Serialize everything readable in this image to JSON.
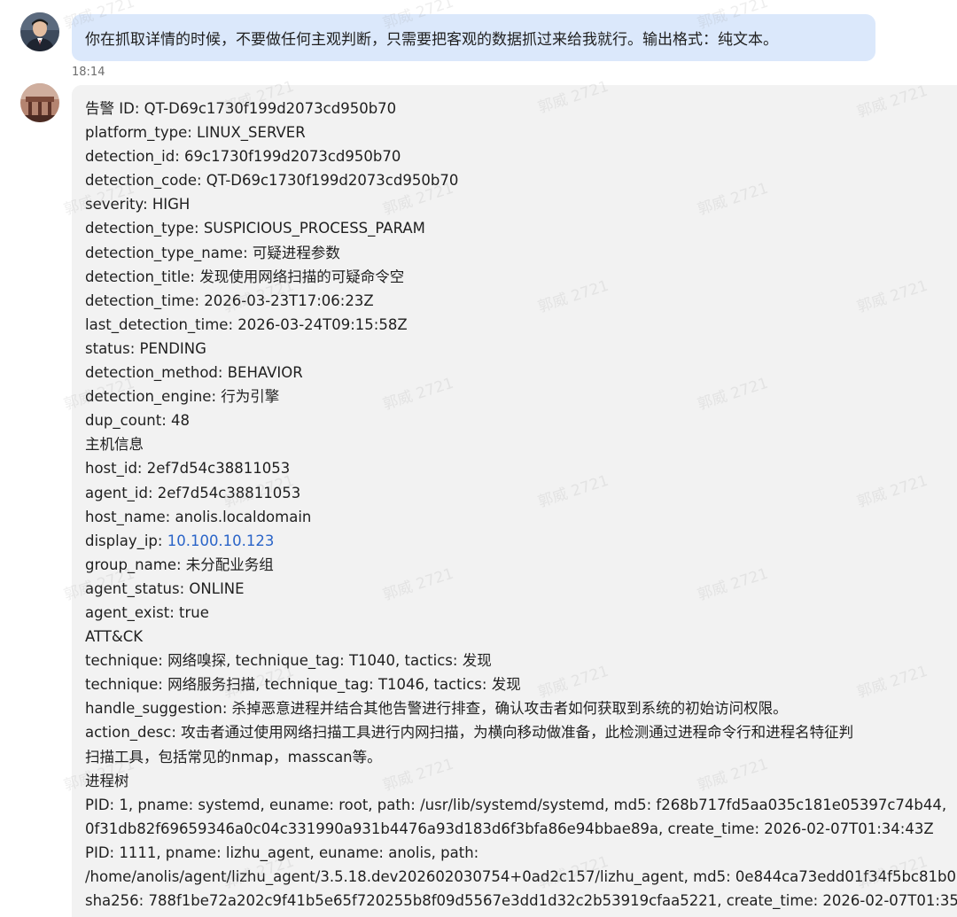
{
  "conversation": {
    "user_message": "你在抓取详情的时候，不要做任何主观判断，只需要把客观的数据抓过来给我就行。输出格式：纯文本。",
    "timestamp": "18:14",
    "watermark_text": "郭威 2721",
    "reply": {
      "line_01": "告警 ID: QT-D69c1730f199d2073cd950b70",
      "line_02": "platform_type: LINUX_SERVER",
      "line_03": "detection_id: 69c1730f199d2073cd950b70",
      "line_04": "detection_code: QT-D69c1730f199d2073cd950b70",
      "line_05": "severity: HIGH",
      "line_06": "detection_type: SUSPICIOUS_PROCESS_PARAM",
      "line_07": "detection_type_name: 可疑进程参数",
      "line_08": "detection_title: 发现使用网络扫描的可疑命令空",
      "line_09": "detection_time: 2026-03-23T17:06:23Z",
      "line_10": "last_detection_time: 2026-03-24T09:15:58Z",
      "line_11": "status: PENDING",
      "line_12": "detection_method: BEHAVIOR",
      "line_13": "detection_engine: 行为引擎",
      "line_14": "dup_count: 48",
      "line_15": "主机信息",
      "line_16": "host_id: 2ef7d54c38811053",
      "line_17": "agent_id: 2ef7d54c38811053",
      "line_18": "host_name: anolis.localdomain",
      "line_19_label": "display_ip: ",
      "line_19_ip": "10.100.10.123",
      "line_20": "group_name: 未分配业务组",
      "line_21": "agent_status: ONLINE",
      "line_22": "agent_exist: true",
      "line_23": "ATT&CK",
      "line_24": "technique: 网络嗅探, technique_tag: T1040, tactics: 发现",
      "line_25": "technique: 网络服务扫描, technique_tag: T1046, tactics: 发现",
      "line_26": "handle_suggestion: 杀掉恶意进程并结合其他告警进行排查，确认攻击者如何获取到系统的初始访问权限。",
      "line_27": "action_desc: 攻击者通过使用网络扫描工具进行内网扫描，为横向移动做准备，此检测通过进程命令行和进程名特征判",
      "line_28": "扫描工具，包括常见的nmap，masscan等。",
      "line_29": "进程树",
      "line_30": "PID: 1, pname: systemd, euname: root, path: /usr/lib/systemd/systemd, md5: f268b717fd5aa035c181e05397c74b44,",
      "line_31": "0f31db82f69659346a0c04c331990a931b4476a93d183d6f3bfa86e94bbae89a, create_time: 2026-02-07T01:34:43Z",
      "line_32": "PID: 1111, pname: lizhu_agent, euname: anolis, path:",
      "line_33": "/home/anolis/agent/lizhu_agent/3.5.18.dev202602030754+0ad2c157/lizhu_agent, md5: 0e844ca73edd01f34f5bc81b0",
      "line_34": "sha256: 788f1be72a202c9f41b5e65f720255b8f09d5567e3dd1d32c2b53919cfaa5221, create_time: 2026-02-07T01:35"
    }
  },
  "colors": {
    "user_bubble": "#dbe8fb",
    "bot_bubble": "#f2f2f2",
    "link": "#2a64c8",
    "timestamp": "#6e6e6e",
    "text": "#1f1f1f"
  },
  "icons": {
    "user_avatar": "user-avatar-icon",
    "bot_avatar": "bot-avatar-icon"
  }
}
